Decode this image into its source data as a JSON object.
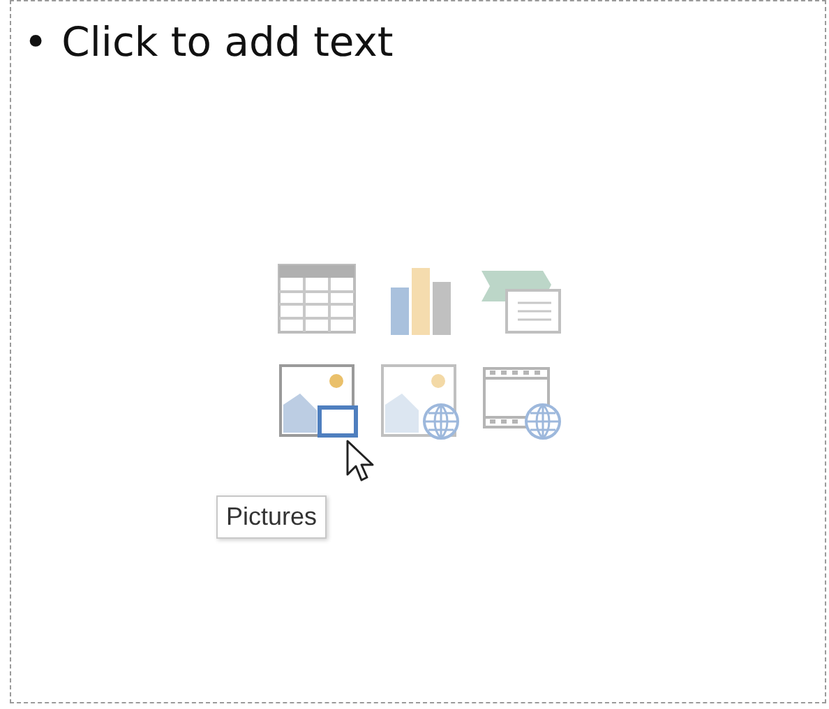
{
  "placeholder": {
    "bullet": "•",
    "text": "Click to add text"
  },
  "icons": [
    {
      "kind": "table"
    },
    {
      "kind": "chart"
    },
    {
      "kind": "smartart"
    },
    {
      "kind": "pictures"
    },
    {
      "kind": "online-pictures"
    },
    {
      "kind": "video"
    }
  ],
  "tooltip": {
    "text": "Pictures"
  }
}
